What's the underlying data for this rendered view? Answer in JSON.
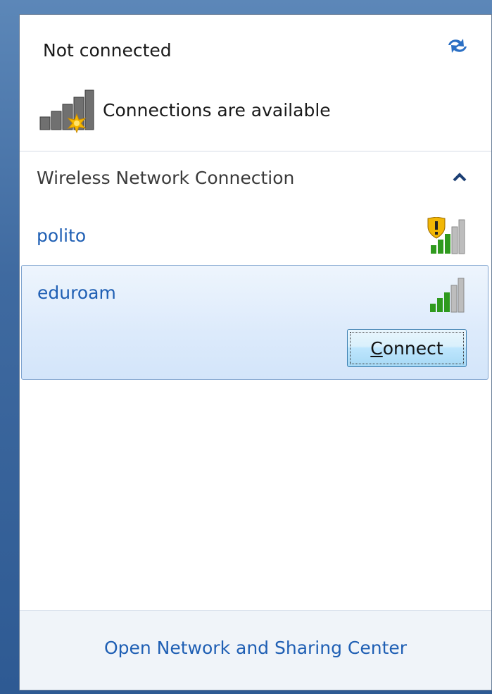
{
  "status": {
    "title": "Not connected",
    "availability": "Connections are available",
    "refresh_icon": "refresh-arrows-icon",
    "availability_icon": "network-available-icon"
  },
  "section": {
    "title": "Wireless Network Connection",
    "collapse_icon": "chevron-up-icon"
  },
  "networks": [
    {
      "name": "polito",
      "secured": false,
      "signal_bars": 3,
      "signal_max": 5,
      "icon": "signal-shield-icon"
    },
    {
      "name": "eduroam",
      "secured": true,
      "signal_bars": 3,
      "signal_max": 5,
      "icon": "signal-icon",
      "selected": true,
      "connect_prefix": "C",
      "connect_rest": "onnect"
    }
  ],
  "footer": {
    "link": "Open Network and Sharing Center"
  },
  "colors": {
    "link": "#1f5fb4",
    "selection": "#dceafb",
    "signal_green": "#2f9a1e",
    "signal_gray": "#a0a0a0"
  }
}
